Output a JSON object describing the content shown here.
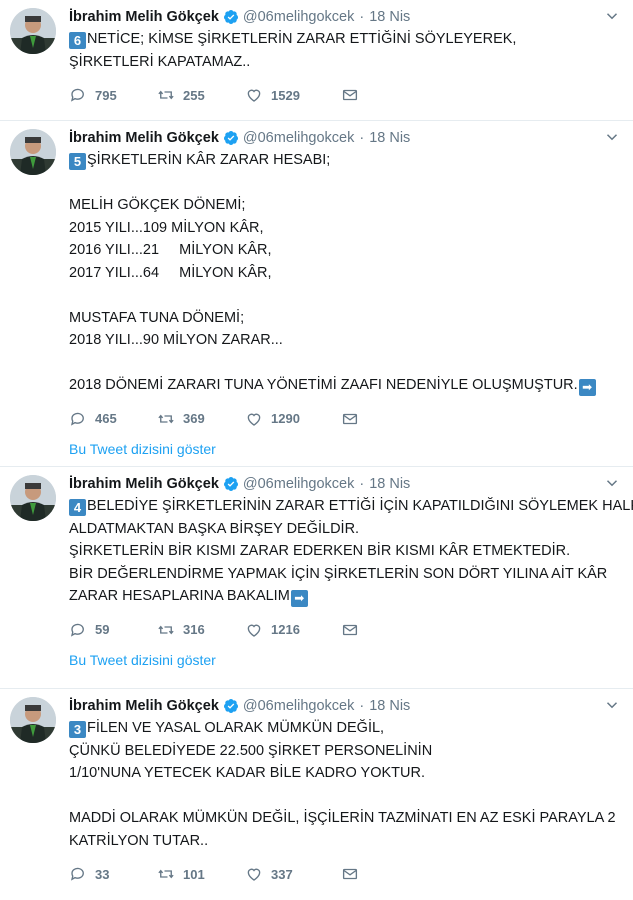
{
  "author": {
    "name": "İbrahim Melih Gökçek",
    "handle": "@06melihgokcek"
  },
  "thread_link_label": "Bu Tweet dizisini göster",
  "tweets": [
    {
      "time": "18 Nis",
      "badge": "6",
      "lines": [
        "NETİCE; KİMSE ŞİRKETLERİN ZARAR ETTİĞİNİ SÖYLEYEREK,",
        "ŞİRKETLERİ KAPATAMAZ.."
      ],
      "replies": "795",
      "retweets": "255",
      "likes": "1529"
    },
    {
      "time": "18 Nis",
      "badge": "5",
      "lines": [
        "ŞİRKETLERİN KÂR ZARAR HESABI;",
        "",
        "MELİH GÖKÇEK DÖNEMİ;",
        "2015 YILI...109 MİLYON KÂR,",
        "2016 YILI...21     MİLYON KÂR,",
        "2017 YILI...64     MİLYON KÂR,",
        "",
        "MUSTAFA TUNA DÖNEMİ;",
        "2018 YILI...90 MİLYON ZARAR...",
        "",
        "2018 DÖNEMİ ZARARI TUNA YÖNETİMİ ZAAFI NEDENİYLE OLUŞMUŞTUR."
      ],
      "replies": "465",
      "retweets": "369",
      "likes": "1290"
    },
    {
      "time": "18 Nis",
      "badge": "4",
      "lines": [
        "BELEDİYE ŞİRKETLERİNİN ZARAR ETTİĞİ İÇİN KAPATILDIĞINI SÖYLEMEK HALKI",
        "ALDATMAKTAN BAŞKA BİRŞEY DEĞİLDİR.",
        "ŞİRKETLERİN BİR KISMI ZARAR EDERKEN BİR KISMI KÂR ETMEKTEDİR.",
        "BİR DEĞERLENDİRME YAPMAK İÇİN ŞİRKETLERİN SON DÖRT YILINA AİT KÂR",
        "ZARAR HESAPLARINA BAKALIM"
      ],
      "replies": "59",
      "retweets": "316",
      "likes": "1216"
    },
    {
      "time": "18 Nis",
      "badge": "3",
      "lines": [
        "FİLEN VE YASAL OLARAK MÜMKÜN DEĞİL,",
        "ÇÜNKÜ BELEDİYEDE 22.500 ŞİRKET PERSONELİNİN",
        "1/10'NUNA YETECEK KADAR BİLE KADRO YOKTUR.",
        "",
        "MADDİ OLARAK MÜMKÜN DEĞİL, İŞÇİLERİN TAZMİNATI EN AZ ESKİ PARAYLA 2",
        "KATRİLYON TUTAR.."
      ],
      "replies": "33",
      "retweets": "101",
      "likes": "337"
    }
  ]
}
